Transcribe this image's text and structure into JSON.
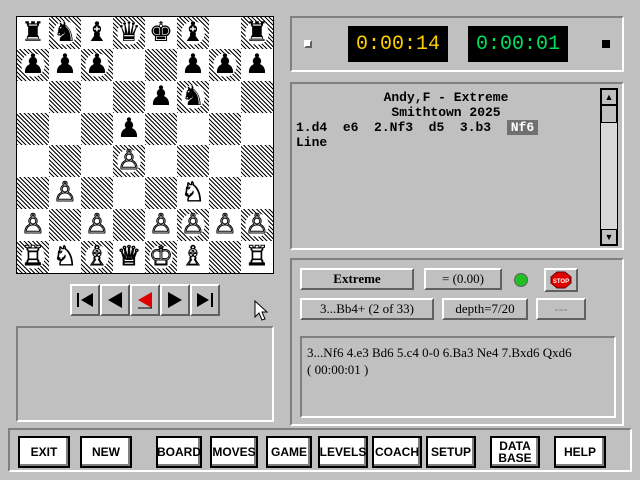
{
  "board": {
    "rows": [
      [
        {
          "p": "♜",
          "c": "b"
        },
        {
          "p": "♞",
          "c": "b"
        },
        {
          "p": "♝",
          "c": "b"
        },
        {
          "p": "♛",
          "c": "b"
        },
        {
          "p": "♚",
          "c": "b"
        },
        {
          "p": "♝",
          "c": "b"
        },
        {
          "p": "",
          "c": ""
        },
        {
          "p": "♜",
          "c": "b"
        }
      ],
      [
        {
          "p": "♟",
          "c": "b"
        },
        {
          "p": "♟",
          "c": "b"
        },
        {
          "p": "♟",
          "c": "b"
        },
        {
          "p": "",
          "c": ""
        },
        {
          "p": "",
          "c": ""
        },
        {
          "p": "♟",
          "c": "b"
        },
        {
          "p": "♟",
          "c": "b"
        },
        {
          "p": "♟",
          "c": "b"
        }
      ],
      [
        {
          "p": "",
          "c": ""
        },
        {
          "p": "",
          "c": ""
        },
        {
          "p": "",
          "c": ""
        },
        {
          "p": "",
          "c": ""
        },
        {
          "p": "♟",
          "c": "b"
        },
        {
          "p": "♞",
          "c": "b"
        },
        {
          "p": "",
          "c": ""
        },
        {
          "p": "",
          "c": ""
        }
      ],
      [
        {
          "p": "",
          "c": ""
        },
        {
          "p": "",
          "c": ""
        },
        {
          "p": "",
          "c": ""
        },
        {
          "p": "♟",
          "c": "b"
        },
        {
          "p": "",
          "c": ""
        },
        {
          "p": "",
          "c": ""
        },
        {
          "p": "",
          "c": ""
        },
        {
          "p": "",
          "c": ""
        }
      ],
      [
        {
          "p": "",
          "c": ""
        },
        {
          "p": "",
          "c": ""
        },
        {
          "p": "",
          "c": ""
        },
        {
          "p": "♙",
          "c": "w"
        },
        {
          "p": "",
          "c": ""
        },
        {
          "p": "",
          "c": ""
        },
        {
          "p": "",
          "c": ""
        },
        {
          "p": "",
          "c": ""
        }
      ],
      [
        {
          "p": "",
          "c": ""
        },
        {
          "p": "♙",
          "c": "w"
        },
        {
          "p": "",
          "c": ""
        },
        {
          "p": "",
          "c": ""
        },
        {
          "p": "",
          "c": ""
        },
        {
          "p": "♘",
          "c": "w"
        },
        {
          "p": "",
          "c": ""
        },
        {
          "p": "",
          "c": ""
        }
      ],
      [
        {
          "p": "♙",
          "c": "w"
        },
        {
          "p": "",
          "c": ""
        },
        {
          "p": "♙",
          "c": "w"
        },
        {
          "p": "",
          "c": ""
        },
        {
          "p": "♙",
          "c": "w"
        },
        {
          "p": "♙",
          "c": "w"
        },
        {
          "p": "♙",
          "c": "w"
        },
        {
          "p": "♙",
          "c": "w"
        }
      ],
      [
        {
          "p": "♖",
          "c": "w"
        },
        {
          "p": "♘",
          "c": "w"
        },
        {
          "p": "♗",
          "c": "w"
        },
        {
          "p": "♕",
          "c": "w"
        },
        {
          "p": "♔",
          "c": "w"
        },
        {
          "p": "♗",
          "c": "w"
        },
        {
          "p": "",
          "c": ""
        },
        {
          "p": "♖",
          "c": "w"
        }
      ]
    ]
  },
  "clocks": {
    "white": "0:00:14",
    "black": "0:00:01"
  },
  "notation": {
    "header1": "Andy,F - Extreme",
    "header2": "Smithtown 2025",
    "moves": [
      "1.d4",
      "e6",
      "2.Nf3",
      "d5",
      "3.b3"
    ],
    "current_move": "Nf6",
    "line_label": "Line"
  },
  "analysis": {
    "level": "Extreme",
    "score": "= (0.00)",
    "stop_label": "STOP",
    "best_move": "3...Bb4+ (2 of 33)",
    "depth": "depth=7/20",
    "extra": "---",
    "pv_line": "3...Nf6 4.e3 Bd6 5.c4 0-0 6.Ba3 Ne4 7.Bxd6 Qxd6",
    "pv_time": "( 00:00:01 )"
  },
  "toolbar": {
    "exit": "EXIT",
    "new": "NEW",
    "board": "BOARD",
    "moves": "MOVES",
    "game": "GAME",
    "levels": "LEVELS",
    "coach": "COACH",
    "setup": "SETUP",
    "data1": "DATA",
    "data2": "BASE",
    "help": "HELP"
  },
  "colors": {
    "panel": "#c0c0c0",
    "clock_white": "#ffd000",
    "clock_black": "#00e060",
    "stop_red": "#e00000"
  }
}
